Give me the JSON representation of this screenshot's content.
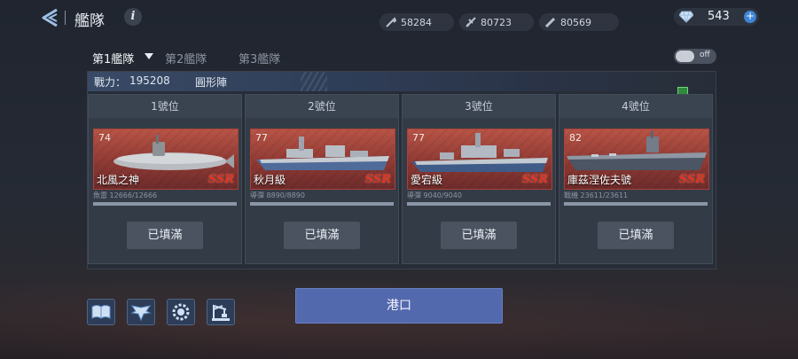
{
  "header": {
    "title": "艦隊",
    "info_label": "i",
    "resources": [
      {
        "icon": "wrench-icon",
        "value": "58284"
      },
      {
        "icon": "aircraft-icon",
        "value": "80723"
      },
      {
        "icon": "missile-icon",
        "value": "80569"
      }
    ],
    "gems": {
      "icon": "diamond-icon",
      "value": "543",
      "plus": "+"
    }
  },
  "tabs": [
    {
      "label": "第1艦隊",
      "active": true
    },
    {
      "label": "第2艦隊",
      "active": false
    },
    {
      "label": "第3艦隊",
      "active": false
    }
  ],
  "toggle": {
    "label": "off",
    "state": false
  },
  "fleet": {
    "power_label": "戰力：",
    "power_value": "195208",
    "formation": "圓形陣"
  },
  "slots": [
    {
      "label": "1號位",
      "level": "74",
      "ship": "北風之神",
      "rarity": "SSR",
      "ammo": "魚雷 12666/12666",
      "ammo_fraction": 1.0,
      "button": "已填滿"
    },
    {
      "label": "2號位",
      "level": "77",
      "ship": "秋月級",
      "rarity": "SSR",
      "ammo": "導彈 8890/8890",
      "ammo_fraction": 1.0,
      "button": "已填滿"
    },
    {
      "label": "3號位",
      "level": "77",
      "ship": "愛宕級",
      "rarity": "SSR",
      "ammo": "導彈 9040/9040",
      "ammo_fraction": 1.0,
      "button": "已填滿"
    },
    {
      "label": "4號位",
      "level": "82",
      "ship": "庫茲涅佐夫號",
      "rarity": "SSR",
      "ammo": "戰機 23611/23611",
      "ammo_fraction": 1.0,
      "button": "已填滿"
    }
  ],
  "bottom": {
    "icons": [
      "book-icon",
      "wings-badge-icon",
      "gear-icon",
      "crane-icon"
    ],
    "port_button": "港口"
  },
  "colors": {
    "accent": "#5369ad",
    "rarity": "#e2331e",
    "card": "#a5423a"
  }
}
